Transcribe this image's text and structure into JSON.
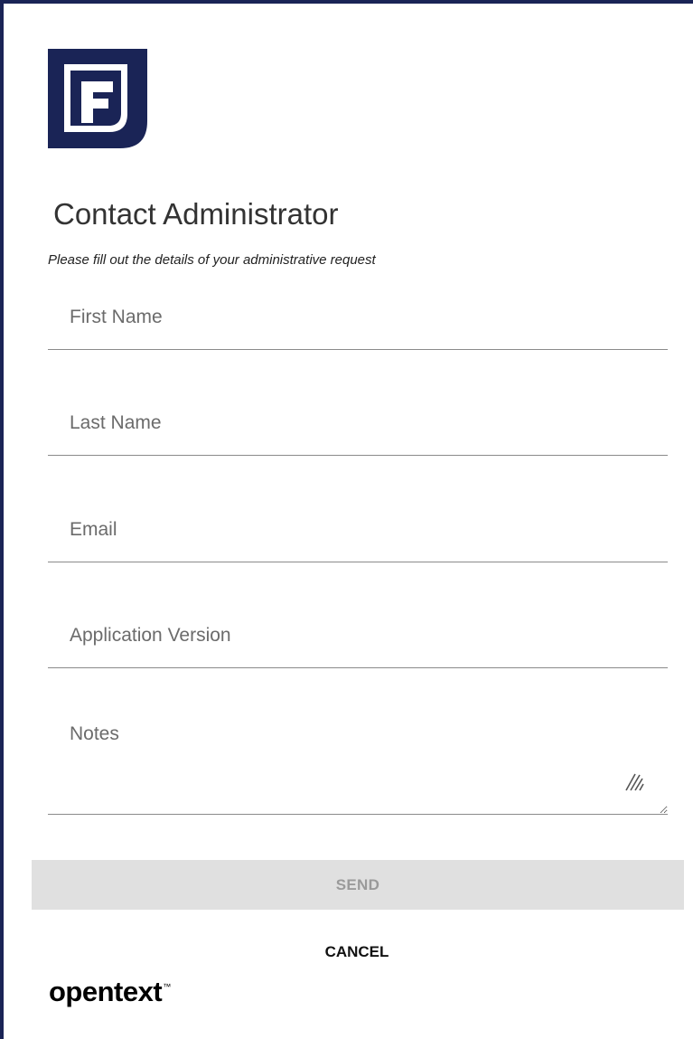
{
  "app": {
    "logo_icon": "f-logo-icon",
    "brand_color": "#1a2456"
  },
  "form": {
    "title": "Contact Administrator",
    "subtitle": "Please fill out the details of your administrative request",
    "fields": {
      "first_name": {
        "placeholder": "First Name",
        "value": ""
      },
      "last_name": {
        "placeholder": "Last Name",
        "value": ""
      },
      "email": {
        "placeholder": "Email",
        "value": ""
      },
      "app_version": {
        "placeholder": "Application Version",
        "value": ""
      },
      "notes": {
        "placeholder": "Notes",
        "value": ""
      }
    },
    "send_label": "SEND",
    "cancel_label": "CANCEL"
  },
  "footer": {
    "brand": "opentext",
    "trademark": "™"
  }
}
